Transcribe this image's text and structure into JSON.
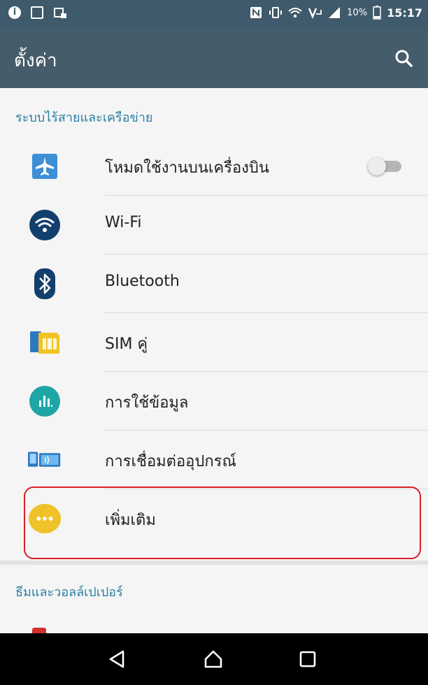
{
  "status_bar": {
    "battery": "10%",
    "time": "15:17"
  },
  "app_bar": {
    "title": "ตั้งค่า"
  },
  "section_wireless": "ระบบไร้สายและเครือข่าย",
  "items": [
    {
      "label": "โหมดใช้งานบนเครื่องบิน",
      "icon": "airplane-icon"
    },
    {
      "label": "Wi-Fi",
      "icon": "wifi-icon"
    },
    {
      "label": "Bluetooth",
      "icon": "bluetooth-icon"
    },
    {
      "label": "SIM คู่",
      "icon": "sim-card-icon"
    },
    {
      "label": "การใช้ข้อมูล",
      "icon": "data-usage-icon"
    },
    {
      "label": "การเชื่อมต่ออุปกรณ์",
      "icon": "device-connection-icon"
    },
    {
      "label": "เพิ่มเติม",
      "icon": "more-icon"
    }
  ],
  "airplane_mode_enabled": false,
  "section_themes": "ธีมและวอลล์เปเปอร์",
  "colors": {
    "status_bar": "#3f5a6b",
    "app_bar": "#455c6b",
    "accent": "#2a7fa4",
    "highlight_border": "#d81f26"
  }
}
